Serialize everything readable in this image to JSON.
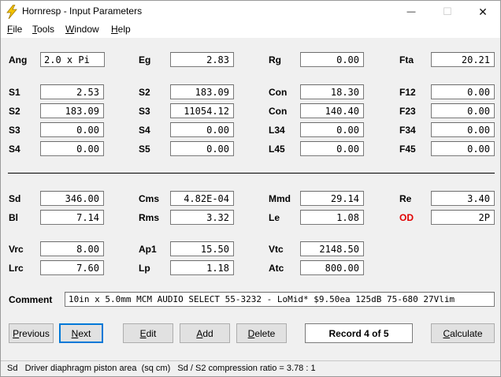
{
  "window": {
    "title": "Hornresp - Input Parameters",
    "minimize_glyph": "—",
    "maximize_glyph": "☐",
    "close_glyph": "✕"
  },
  "menu": {
    "file": {
      "first": "F",
      "rest": "ile"
    },
    "tools": {
      "first": "T",
      "rest": "ools"
    },
    "window": {
      "first": "W",
      "rest": "indow"
    },
    "help": {
      "first": "H",
      "rest": "elp"
    }
  },
  "params": {
    "ang": {
      "label": "Ang",
      "value": "2.0 x Pi"
    },
    "eg": {
      "label": "Eg",
      "value": "2.83"
    },
    "rg": {
      "label": "Rg",
      "value": "0.00"
    },
    "fta": {
      "label": "Fta",
      "value": "20.21"
    },
    "s1": {
      "label": "S1",
      "value": "2.53"
    },
    "s2a": {
      "label": "S2",
      "value": "183.09"
    },
    "con1": {
      "label": "Con",
      "value": "18.30"
    },
    "f12": {
      "label": "F12",
      "value": "0.00"
    },
    "s2b": {
      "label": "S2",
      "value": "183.09"
    },
    "s3a": {
      "label": "S3",
      "value": "11054.12"
    },
    "con2": {
      "label": "Con",
      "value": "140.40"
    },
    "f23": {
      "label": "F23",
      "value": "0.00"
    },
    "s3b": {
      "label": "S3",
      "value": "0.00"
    },
    "s4a": {
      "label": "S4",
      "value": "0.00"
    },
    "l34": {
      "label": "L34",
      "value": "0.00"
    },
    "f34": {
      "label": "F34",
      "value": "0.00"
    },
    "s4b": {
      "label": "S4",
      "value": "0.00"
    },
    "s5": {
      "label": "S5",
      "value": "0.00"
    },
    "l45": {
      "label": "L45",
      "value": "0.00"
    },
    "f45": {
      "label": "F45",
      "value": "0.00"
    },
    "sd": {
      "label": "Sd",
      "value": "346.00"
    },
    "cms": {
      "label": "Cms",
      "value": "4.82E-04"
    },
    "mmd": {
      "label": "Mmd",
      "value": "29.14"
    },
    "re": {
      "label": "Re",
      "value": "3.40"
    },
    "bl": {
      "label": "Bl",
      "value": "7.14"
    },
    "rms": {
      "label": "Rms",
      "value": "3.32"
    },
    "le": {
      "label": "Le",
      "value": "1.08"
    },
    "od": {
      "label": "OD",
      "value": "2P",
      "label_color": "#e00000"
    },
    "vrc": {
      "label": "Vrc",
      "value": "8.00"
    },
    "ap1": {
      "label": "Ap1",
      "value": "15.50"
    },
    "vtc": {
      "label": "Vtc",
      "value": "2148.50"
    },
    "lrc": {
      "label": "Lrc",
      "value": "7.60"
    },
    "lp": {
      "label": "Lp",
      "value": "1.18"
    },
    "atc": {
      "label": "Atc",
      "value": "800.00"
    }
  },
  "comment": {
    "label": "Comment",
    "value": "10in x 5.0mm MCM AUDIO SELECT 55-3232 - LoMid* $9.50ea 125dB 75-680 27Vlim"
  },
  "buttons": {
    "previous": {
      "first": "P",
      "rest": "revious"
    },
    "next": {
      "first": "N",
      "rest": "ext"
    },
    "edit": {
      "first": "E",
      "rest": "dit"
    },
    "add": {
      "first": "A",
      "rest": "dd"
    },
    "delete": {
      "first": "D",
      "rest": "elete"
    },
    "calculate": {
      "first": "C",
      "rest": "alculate"
    }
  },
  "record": "Record 4 of 5",
  "status": "Sd   Driver diaphragm piston area  (sq cm)   Sd / S2 compression ratio = 3.78 : 1",
  "colors": {
    "focus_accent": "#0078d7",
    "od_label": "#e00000",
    "icon_yellow": "#f5c400"
  }
}
